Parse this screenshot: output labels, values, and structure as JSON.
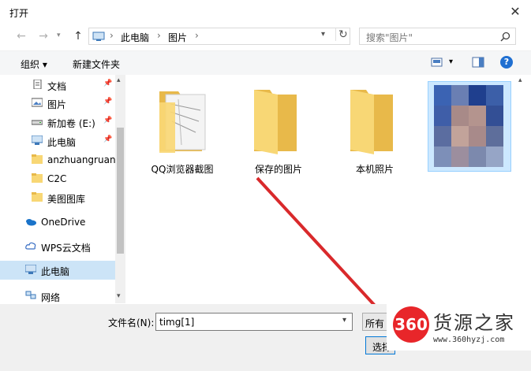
{
  "window": {
    "title": "打开",
    "close_glyph": "✕"
  },
  "nav": {
    "back_glyph": "←",
    "forward_glyph": "→",
    "up_glyph": "↑",
    "breadcrumb": [
      "此电脑",
      "图片"
    ],
    "sep": "›",
    "refresh_glyph": "↻",
    "search_placeholder": "搜索\"图片\""
  },
  "toolbar": {
    "organize": "组织 ▾",
    "new_folder": "新建文件夹",
    "view_glyph": "▾",
    "help_glyph": "?"
  },
  "sidebar": {
    "items": [
      {
        "label": "文档",
        "icon": "document-icon",
        "pinned": true
      },
      {
        "label": "图片",
        "icon": "pictures-icon",
        "pinned": true
      },
      {
        "label": "新加卷 (E:)",
        "icon": "drive-icon",
        "pinned": true
      },
      {
        "label": "此电脑",
        "icon": "computer-icon",
        "pinned": true
      },
      {
        "label": "anzhuangruanj",
        "icon": "folder-icon",
        "pinned": false
      },
      {
        "label": "C2C",
        "icon": "folder-icon",
        "pinned": false
      },
      {
        "label": "美图图库",
        "icon": "folder-icon",
        "pinned": false
      },
      {
        "label": "OneDrive",
        "icon": "onedrive-icon",
        "pinned": false
      },
      {
        "label": "WPS云文档",
        "icon": "cloud-icon",
        "pinned": false
      },
      {
        "label": "此电脑",
        "icon": "computer-icon",
        "pinned": false,
        "selected": true
      },
      {
        "label": "网络",
        "icon": "network-icon",
        "pinned": false
      }
    ],
    "pin_glyph": "📌"
  },
  "content": {
    "folders": [
      {
        "label": "QQ浏览器截图"
      },
      {
        "label": "保存的图片"
      },
      {
        "label": "本机照片"
      }
    ]
  },
  "bottom": {
    "filename_label": "文件名(N):",
    "filename_value": "timg[1]",
    "filetype_label": "所有",
    "open_label": "选择"
  },
  "watermark": {
    "badge": "360",
    "brand": "货源之家",
    "url": "www.360hyzj.com"
  },
  "colors": {
    "folder": "#f8d775",
    "folder_dark": "#e8b94a",
    "accent": "#0078d7",
    "arrow": "#d9292b"
  }
}
